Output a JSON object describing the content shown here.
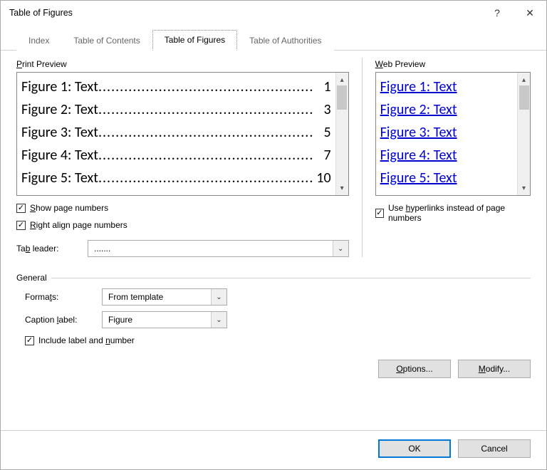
{
  "window": {
    "title": "Table of Figures",
    "help_glyph": "?",
    "close_glyph": "✕"
  },
  "tabs": {
    "index": "Index",
    "toc": "Table of Contents",
    "tof": "Table of Figures",
    "toa": "Table of Authorities"
  },
  "print_preview": {
    "label_pre": "",
    "label_u": "P",
    "label_post": "rint Preview",
    "items": [
      {
        "label": "Figure 1: Text",
        "page": "1"
      },
      {
        "label": "Figure 2: Text",
        "page": "3"
      },
      {
        "label": "Figure 3: Text",
        "page": "5"
      },
      {
        "label": "Figure 4: Text",
        "page": "7"
      },
      {
        "label": "Figure 5: Text",
        "page": "10"
      }
    ],
    "show_page_numbers_u": "S",
    "show_page_numbers_post": "how page numbers",
    "right_align_u": "R",
    "right_align_post": "ight align page numbers",
    "tab_leader_label_pre": "Ta",
    "tab_leader_label_u": "b",
    "tab_leader_label_post": " leader:",
    "tab_leader_value": "......."
  },
  "web_preview": {
    "label_u": "W",
    "label_post": "eb Preview",
    "items": [
      "Figure 1: Text",
      "Figure 2: Text",
      "Figure 3: Text",
      "Figure 4: Text",
      "Figure 5: Text"
    ],
    "use_hyperlinks_pre": "Use ",
    "use_hyperlinks_u": "h",
    "use_hyperlinks_post": "yperlinks instead of page numbers"
  },
  "general": {
    "section_label": "General",
    "formats_label_pre": "Forma",
    "formats_label_u": "t",
    "formats_label_post": "s:",
    "formats_value": "From template",
    "caption_label_pre": "Caption ",
    "caption_label_u": "l",
    "caption_label_post": "abel:",
    "caption_value": "Figure",
    "include_label_pre": "Include label and ",
    "include_label_u": "n",
    "include_label_post": "umber"
  },
  "buttons": {
    "options_u": "O",
    "options_post": "ptions...",
    "modify_u": "M",
    "modify_post": "odify...",
    "ok": "OK",
    "cancel": "Cancel"
  },
  "glyphs": {
    "chevron_down": "⌄",
    "scroll_up": "▴",
    "scroll_down": "▾",
    "dots": ".................................................."
  }
}
